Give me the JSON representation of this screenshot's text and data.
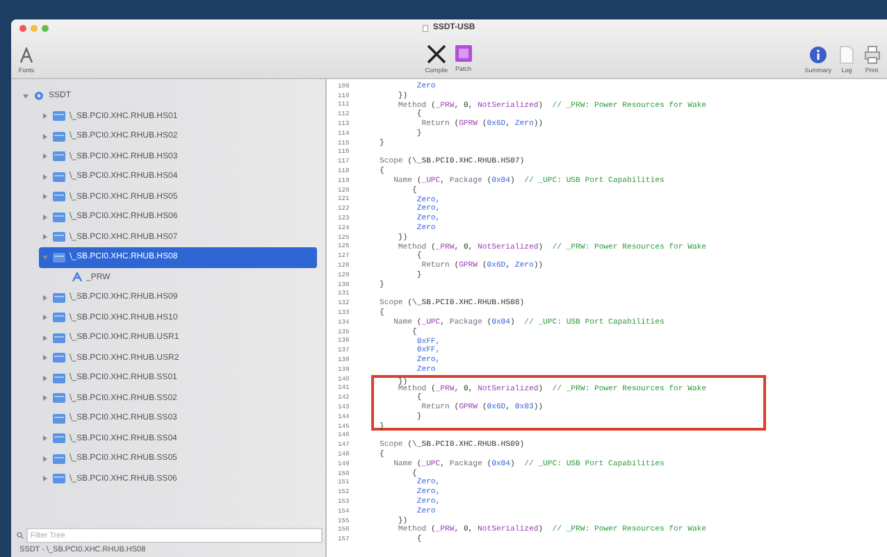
{
  "window": {
    "title": "SSDT-USB"
  },
  "toolbar": {
    "left": [
      {
        "label": "Fonts",
        "kind": "fonts"
      }
    ],
    "center": [
      {
        "label": "Compile",
        "kind": "compile"
      },
      {
        "label": "Patch",
        "kind": "patch"
      }
    ],
    "right": [
      {
        "label": "Summary",
        "kind": "summary"
      },
      {
        "label": "Log",
        "kind": "log"
      },
      {
        "label": "Print",
        "kind": "print"
      }
    ]
  },
  "sidebar": {
    "items": [
      {
        "label": "SSDT",
        "kind": "root",
        "expandable": true,
        "expanded": true,
        "selected": false,
        "children": [
          {
            "label": "\\_SB.PCI0.XHC.RHUB.HS01",
            "kind": "device",
            "expandable": true,
            "expanded": false,
            "selected": false
          },
          {
            "label": "\\_SB.PCI0.XHC.RHUB.HS02",
            "kind": "device",
            "expandable": true,
            "expanded": false,
            "selected": false
          },
          {
            "label": "\\_SB.PCI0.XHC.RHUB.HS03",
            "kind": "device",
            "expandable": true,
            "expanded": false,
            "selected": false
          },
          {
            "label": "\\_SB.PCI0.XHC.RHUB.HS04",
            "kind": "device",
            "expandable": true,
            "expanded": false,
            "selected": false
          },
          {
            "label": "\\_SB.PCI0.XHC.RHUB.HS05",
            "kind": "device",
            "expandable": true,
            "expanded": false,
            "selected": false
          },
          {
            "label": "\\_SB.PCI0.XHC.RHUB.HS06",
            "kind": "device",
            "expandable": true,
            "expanded": false,
            "selected": false
          },
          {
            "label": "\\_SB.PCI0.XHC.RHUB.HS07",
            "kind": "device",
            "expandable": true,
            "expanded": false,
            "selected": false
          },
          {
            "label": "\\_SB.PCI0.XHC.RHUB.HS08",
            "kind": "device",
            "expandable": true,
            "expanded": true,
            "selected": true,
            "children": [
              {
                "label": "_PRW",
                "kind": "method",
                "expandable": false,
                "expanded": false,
                "selected": false
              }
            ]
          },
          {
            "label": "\\_SB.PCI0.XHC.RHUB.HS09",
            "kind": "device",
            "expandable": true,
            "expanded": false,
            "selected": false
          },
          {
            "label": "\\_SB.PCI0.XHC.RHUB.HS10",
            "kind": "device",
            "expandable": true,
            "expanded": false,
            "selected": false
          },
          {
            "label": "\\_SB.PCI0.XHC.RHUB.USR1",
            "kind": "device",
            "expandable": true,
            "expanded": false,
            "selected": false
          },
          {
            "label": "\\_SB.PCI0.XHC.RHUB.USR2",
            "kind": "device",
            "expandable": true,
            "expanded": false,
            "selected": false
          },
          {
            "label": "\\_SB.PCI0.XHC.RHUB.SS01",
            "kind": "device",
            "expandable": true,
            "expanded": false,
            "selected": false
          },
          {
            "label": "\\_SB.PCI0.XHC.RHUB.SS02",
            "kind": "device",
            "expandable": true,
            "expanded": false,
            "selected": false
          },
          {
            "label": "\\_SB.PCI0.XHC.RHUB.SS03",
            "kind": "device",
            "expandable": false,
            "expanded": false,
            "selected": false
          },
          {
            "label": "\\_SB.PCI0.XHC.RHUB.SS04",
            "kind": "device",
            "expandable": true,
            "expanded": false,
            "selected": false
          },
          {
            "label": "\\_SB.PCI0.XHC.RHUB.SS05",
            "kind": "device",
            "expandable": true,
            "expanded": false,
            "selected": false
          },
          {
            "label": "\\_SB.PCI0.XHC.RHUB.SS06",
            "kind": "device",
            "expandable": true,
            "expanded": false,
            "selected": false
          }
        ]
      }
    ],
    "search": {
      "placeholder": "Filter Tree"
    },
    "status": "SSDT - \\_SB.PCI0.XHC.RHUB.HS08"
  },
  "editor": {
    "lines": [
      {
        "n": "109",
        "highlighted": false,
        "tokens": [
          {
            "kind": "const",
            "text": "        Zero"
          }
        ]
      },
      {
        "n": "110",
        "highlighted": false,
        "tokens": [
          {
            "kind": "plain",
            "text": "    })"
          }
        ]
      },
      {
        "n": "111",
        "highlighted": false,
        "tokens": [
          {
            "kind": "kw",
            "text": "    Method "
          },
          {
            "kind": "plain",
            "text": "("
          },
          {
            "kind": "name",
            "text": "_PRW"
          },
          {
            "kind": "plain",
            "text": ", 0, "
          },
          {
            "kind": "name",
            "text": "NotSerialized"
          },
          {
            "kind": "plain",
            "text": ")  "
          },
          {
            "kind": "comment",
            "text": "// _PRW: Power Resources for Wake"
          }
        ]
      },
      {
        "n": "112",
        "highlighted": false,
        "tokens": [
          {
            "kind": "plain",
            "text": "        {"
          }
        ]
      },
      {
        "n": "113",
        "highlighted": false,
        "tokens": [
          {
            "kind": "kw",
            "text": "         Return "
          },
          {
            "kind": "plain",
            "text": "("
          },
          {
            "kind": "name",
            "text": "GPRW"
          },
          {
            "kind": "plain",
            "text": " ("
          },
          {
            "kind": "const",
            "text": "0x6D"
          },
          {
            "kind": "plain",
            "text": ", "
          },
          {
            "kind": "const",
            "text": "Zero"
          },
          {
            "kind": "plain",
            "text": "))"
          }
        ]
      },
      {
        "n": "114",
        "highlighted": false,
        "tokens": [
          {
            "kind": "plain",
            "text": "        }"
          }
        ]
      },
      {
        "n": "115",
        "highlighted": false,
        "tokens": [
          {
            "kind": "plain",
            "text": "}"
          }
        ]
      },
      {
        "n": "116"
      },
      {
        "n": "117",
        "highlighted": false,
        "tokens": [
          {
            "kind": "kw",
            "text": "Scope "
          },
          {
            "kind": "plain",
            "text": "(\\_SB.PCI0.XHC.RHUB.HS07)"
          }
        ]
      },
      {
        "n": "118",
        "highlighted": false,
        "tokens": [
          {
            "kind": "plain",
            "text": "{"
          }
        ]
      },
      {
        "n": "119",
        "highlighted": false,
        "tokens": [
          {
            "kind": "kw",
            "text": "   Name "
          },
          {
            "kind": "plain",
            "text": "("
          },
          {
            "kind": "name",
            "text": "_UPC"
          },
          {
            "kind": "plain",
            "text": ", "
          },
          {
            "kind": "kw",
            "text": "Package "
          },
          {
            "kind": "plain",
            "text": "("
          },
          {
            "kind": "const",
            "text": "0x04"
          },
          {
            "kind": "plain",
            "text": ")  "
          },
          {
            "kind": "comment",
            "text": "// _UPC: USB Port Capabilities"
          }
        ]
      },
      {
        "n": "120",
        "highlighted": false,
        "tokens": [
          {
            "kind": "plain",
            "text": "       {"
          }
        ]
      },
      {
        "n": "121",
        "highlighted": false,
        "tokens": [
          {
            "kind": "const",
            "text": "        Zero,"
          }
        ]
      },
      {
        "n": "122",
        "highlighted": false,
        "tokens": [
          {
            "kind": "const",
            "text": "        Zero,"
          }
        ]
      },
      {
        "n": "123",
        "highlighted": false,
        "tokens": [
          {
            "kind": "const",
            "text": "        Zero,"
          }
        ]
      },
      {
        "n": "124",
        "highlighted": false,
        "tokens": [
          {
            "kind": "const",
            "text": "        Zero"
          }
        ]
      },
      {
        "n": "125",
        "highlighted": false,
        "tokens": [
          {
            "kind": "plain",
            "text": "    })"
          }
        ]
      },
      {
        "n": "126",
        "highlighted": false,
        "tokens": [
          {
            "kind": "kw",
            "text": "    Method "
          },
          {
            "kind": "plain",
            "text": "("
          },
          {
            "kind": "name",
            "text": "_PRW"
          },
          {
            "kind": "plain",
            "text": ", 0, "
          },
          {
            "kind": "name",
            "text": "NotSerialized"
          },
          {
            "kind": "plain",
            "text": ")  "
          },
          {
            "kind": "comment",
            "text": "// _PRW: Power Resources for Wake"
          }
        ]
      },
      {
        "n": "127",
        "highlighted": false,
        "tokens": [
          {
            "kind": "plain",
            "text": "        {"
          }
        ]
      },
      {
        "n": "128",
        "highlighted": false,
        "tokens": [
          {
            "kind": "kw",
            "text": "         Return "
          },
          {
            "kind": "plain",
            "text": "("
          },
          {
            "kind": "name",
            "text": "GPRW"
          },
          {
            "kind": "plain",
            "text": " ("
          },
          {
            "kind": "const",
            "text": "0x6D"
          },
          {
            "kind": "plain",
            "text": ", "
          },
          {
            "kind": "const",
            "text": "Zero"
          },
          {
            "kind": "plain",
            "text": "))"
          }
        ]
      },
      {
        "n": "129",
        "highlighted": false,
        "tokens": [
          {
            "kind": "plain",
            "text": "        }"
          }
        ]
      },
      {
        "n": "130",
        "highlighted": false,
        "tokens": [
          {
            "kind": "plain",
            "text": "}"
          }
        ]
      },
      {
        "n": "131"
      },
      {
        "n": "132",
        "highlighted": false,
        "tokens": [
          {
            "kind": "kw",
            "text": "Scope "
          },
          {
            "kind": "plain",
            "text": "(\\_SB.PCI0.XHC.RHUB.HS08)"
          }
        ]
      },
      {
        "n": "133",
        "highlighted": false,
        "tokens": [
          {
            "kind": "plain",
            "text": "{"
          }
        ]
      },
      {
        "n": "134",
        "highlighted": false,
        "tokens": [
          {
            "kind": "kw",
            "text": "   Name "
          },
          {
            "kind": "plain",
            "text": "("
          },
          {
            "kind": "name",
            "text": "_UPC"
          },
          {
            "kind": "plain",
            "text": ", "
          },
          {
            "kind": "kw",
            "text": "Package "
          },
          {
            "kind": "plain",
            "text": "("
          },
          {
            "kind": "const",
            "text": "0x04"
          },
          {
            "kind": "plain",
            "text": ")  "
          },
          {
            "kind": "comment",
            "text": "// _UPC: USB Port Capabilities"
          }
        ]
      },
      {
        "n": "135",
        "highlighted": false,
        "tokens": [
          {
            "kind": "plain",
            "text": "       {"
          }
        ]
      },
      {
        "n": "136",
        "highlighted": false,
        "tokens": [
          {
            "kind": "const",
            "text": "        0xFF,"
          }
        ]
      },
      {
        "n": "137",
        "highlighted": false,
        "tokens": [
          {
            "kind": "const",
            "text": "        0xFF,"
          }
        ]
      },
      {
        "n": "138",
        "highlighted": false,
        "tokens": [
          {
            "kind": "const",
            "text": "        Zero,"
          }
        ]
      },
      {
        "n": "139",
        "highlighted": false,
        "tokens": [
          {
            "kind": "const",
            "text": "        Zero"
          }
        ]
      },
      {
        "n": "140",
        "highlighted": true,
        "tokens": [
          {
            "kind": "plain",
            "text": "    })"
          }
        ]
      },
      {
        "n": "141",
        "highlighted": true,
        "tokens": [
          {
            "kind": "kw",
            "text": "    Method "
          },
          {
            "kind": "plain",
            "text": "("
          },
          {
            "kind": "name",
            "text": "_PRW"
          },
          {
            "kind": "plain",
            "text": ", 0, "
          },
          {
            "kind": "name",
            "text": "NotSerialized"
          },
          {
            "kind": "plain",
            "text": ")  "
          },
          {
            "kind": "comment",
            "text": "// _PRW: Power Resources for Wake"
          }
        ]
      },
      {
        "n": "142",
        "highlighted": true,
        "tokens": [
          {
            "kind": "plain",
            "text": "        {"
          }
        ]
      },
      {
        "n": "143",
        "highlighted": true,
        "tokens": [
          {
            "kind": "kw",
            "text": "         Return "
          },
          {
            "kind": "plain",
            "text": "("
          },
          {
            "kind": "name",
            "text": "GPRW"
          },
          {
            "kind": "plain",
            "text": " ("
          },
          {
            "kind": "const",
            "text": "0x6D"
          },
          {
            "kind": "plain",
            "text": ", "
          },
          {
            "kind": "const",
            "text": "0x03"
          },
          {
            "kind": "plain",
            "text": "))"
          }
        ]
      },
      {
        "n": "144",
        "highlighted": true,
        "tokens": [
          {
            "kind": "plain",
            "text": "        }"
          }
        ]
      },
      {
        "n": "145",
        "highlighted": true,
        "tokens": [
          {
            "kind": "plain",
            "text": "}"
          }
        ]
      },
      {
        "n": "146"
      },
      {
        "n": "147",
        "highlighted": false,
        "tokens": [
          {
            "kind": "kw",
            "text": "Scope "
          },
          {
            "kind": "plain",
            "text": "(\\_SB.PCI0.XHC.RHUB.HS09)"
          }
        ]
      },
      {
        "n": "148",
        "highlighted": false,
        "tokens": [
          {
            "kind": "plain",
            "text": "{"
          }
        ]
      },
      {
        "n": "149",
        "highlighted": false,
        "tokens": [
          {
            "kind": "kw",
            "text": "   Name "
          },
          {
            "kind": "plain",
            "text": "("
          },
          {
            "kind": "name",
            "text": "_UPC"
          },
          {
            "kind": "plain",
            "text": ", "
          },
          {
            "kind": "kw",
            "text": "Package "
          },
          {
            "kind": "plain",
            "text": "("
          },
          {
            "kind": "const",
            "text": "0x04"
          },
          {
            "kind": "plain",
            "text": ")  "
          },
          {
            "kind": "comment",
            "text": "// _UPC: USB Port Capabilities"
          }
        ]
      },
      {
        "n": "150",
        "highlighted": false,
        "tokens": [
          {
            "kind": "plain",
            "text": "       {"
          }
        ]
      },
      {
        "n": "151",
        "highlighted": false,
        "tokens": [
          {
            "kind": "const",
            "text": "        Zero,"
          }
        ]
      },
      {
        "n": "152",
        "highlighted": false,
        "tokens": [
          {
            "kind": "const",
            "text": "        Zero,"
          }
        ]
      },
      {
        "n": "153",
        "highlighted": false,
        "tokens": [
          {
            "kind": "const",
            "text": "        Zero,"
          }
        ]
      },
      {
        "n": "154",
        "highlighted": false,
        "tokens": [
          {
            "kind": "const",
            "text": "        Zero"
          }
        ]
      },
      {
        "n": "155",
        "highlighted": false,
        "tokens": [
          {
            "kind": "plain",
            "text": "    })"
          }
        ]
      },
      {
        "n": "156",
        "highlighted": false,
        "tokens": [
          {
            "kind": "kw",
            "text": "    Method "
          },
          {
            "kind": "plain",
            "text": "("
          },
          {
            "kind": "name",
            "text": "_PRW"
          },
          {
            "kind": "plain",
            "text": ", 0, "
          },
          {
            "kind": "name",
            "text": "NotSerialized"
          },
          {
            "kind": "plain",
            "text": ")  "
          },
          {
            "kind": "comment",
            "text": "// _PRW: Power Resources for Wake"
          }
        ]
      },
      {
        "n": "157",
        "highlighted": false,
        "tokens": [
          {
            "kind": "plain",
            "text": "        {"
          }
        ]
      }
    ]
  }
}
